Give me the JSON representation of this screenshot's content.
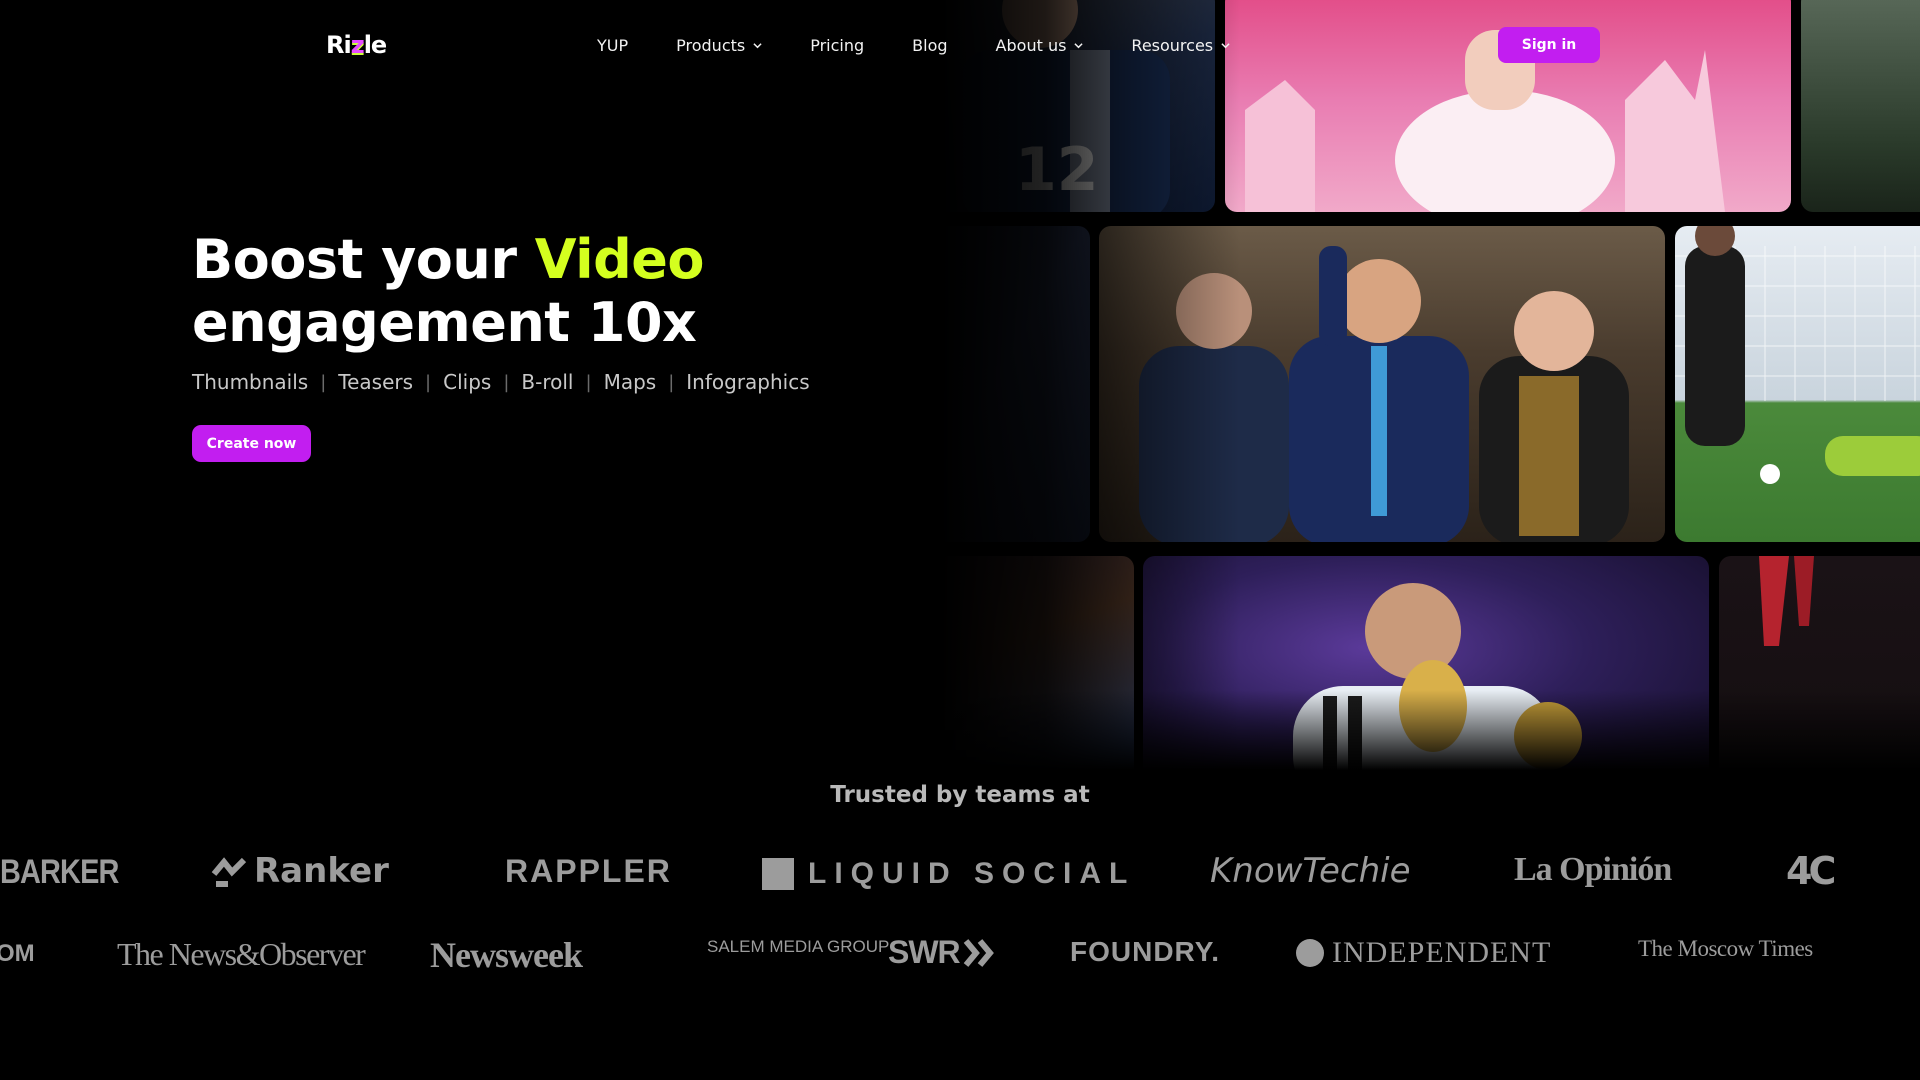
{
  "header": {
    "logo_text": "Ri",
    "logo_z": "z",
    "logo_text_end": "le",
    "nav": [
      {
        "label": "YUP",
        "has_dropdown": false
      },
      {
        "label": "Products",
        "has_dropdown": true
      },
      {
        "label": "Pricing",
        "has_dropdown": false
      },
      {
        "label": "Blog",
        "has_dropdown": false
      },
      {
        "label": "About us",
        "has_dropdown": true
      },
      {
        "label": "Resources",
        "has_dropdown": true
      }
    ],
    "signin_label": "Sign in"
  },
  "hero": {
    "title_part1": "Boost your ",
    "title_accent": "Video",
    "title_part2": "engagement 10x",
    "tags": [
      "Thumbnails",
      "Teasers",
      "Clips",
      "B-roll",
      "Maps",
      "Infographics"
    ],
    "tag_separator": "|",
    "cta_label": "Create now"
  },
  "trusted": {
    "heading": "Trusted by teams at",
    "row1": [
      "BARKER",
      "Ranker",
      "RAPPLER",
      "LIQUID SOCIAL",
      "KnowTechie",
      "La Opinión",
      "4C"
    ],
    "row2": [
      "OM",
      "The News&Observer",
      "Newsweek",
      "SALEM MEDIA GROUP",
      "SWR",
      "FOUNDRY.",
      "INDEPENDENT",
      "The Moscow Times"
    ]
  },
  "colors": {
    "background": "#000000",
    "accent_purple": "#c21ef0",
    "accent_lime": "#d4ff1f",
    "logo_gray": "#9c9c9c"
  }
}
